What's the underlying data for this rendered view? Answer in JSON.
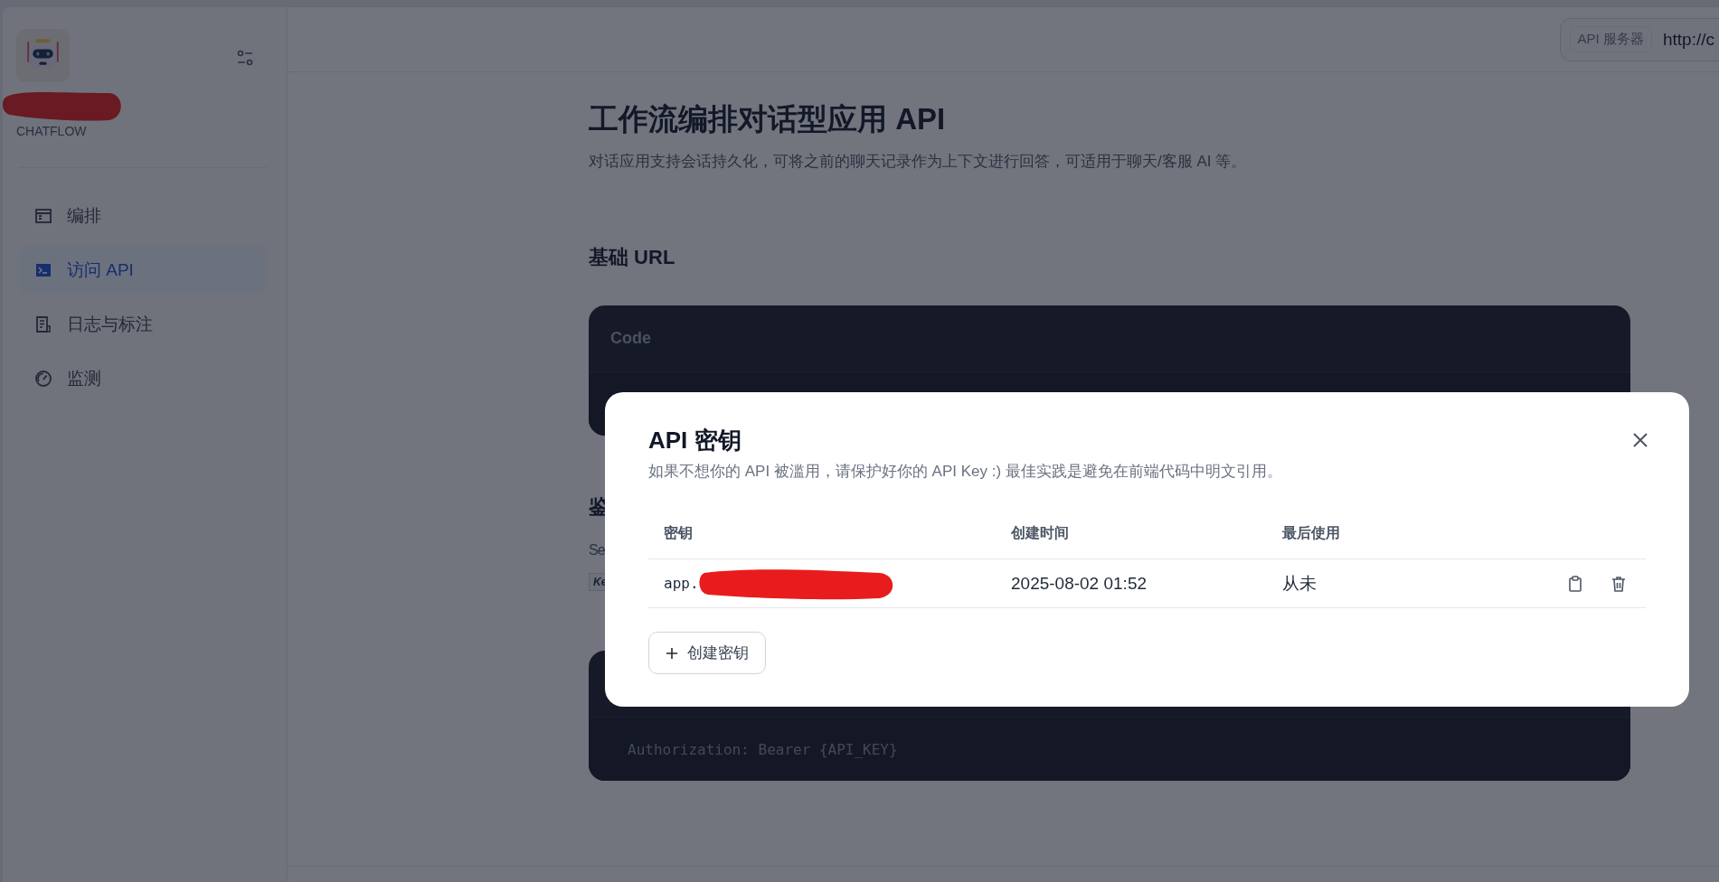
{
  "sidebar": {
    "app_type": "CHATFLOW",
    "items": [
      {
        "label": "编排",
        "selected": false
      },
      {
        "label": "访问 API",
        "selected": true
      },
      {
        "label": "日志与标注",
        "selected": false
      },
      {
        "label": "监测",
        "selected": false
      }
    ]
  },
  "header": {
    "server_label": "API 服务器",
    "server_url": "http://c"
  },
  "content": {
    "title": "工作流编排对话型应用 API",
    "description": "对话应用支持会话持久化，可将之前的聊天记录作为上下文进行回答，可适用于聊天/客服 AI 等。",
    "base_url_heading": "基础 URL",
    "code_header": "Code",
    "auth_heading": "鉴",
    "auth_text": "Se",
    "auth_code": "Ke",
    "auth_code_body": "Authorization: Bearer {API_KEY}"
  },
  "modal": {
    "title": "API 密钥",
    "description": "如果不想你的 API 被滥用，请保护好你的 API Key :) 最佳实践是避免在前端代码中明文引用。",
    "columns": [
      "密钥",
      "创建时间",
      "最后使用"
    ],
    "rows": [
      {
        "key": "app.",
        "created": "2025-08-02 01:52",
        "last_used": "从未"
      }
    ],
    "create_button": "创建密钥"
  }
}
